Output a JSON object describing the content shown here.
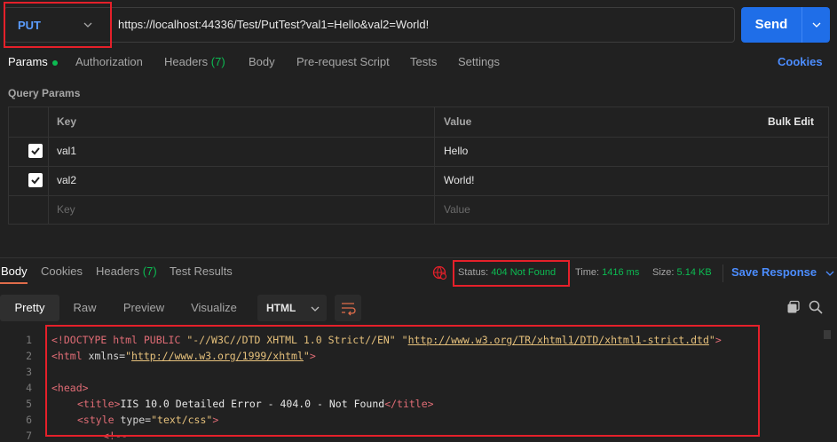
{
  "request": {
    "method": "PUT",
    "url": "https://localhost:44336/Test/PutTest?val1=Hello&val2=World!",
    "send_label": "Send"
  },
  "request_tabs": {
    "params": "Params",
    "authorization": "Authorization",
    "headers": "Headers",
    "headers_count": "(7)",
    "body": "Body",
    "prerequest": "Pre-request Script",
    "tests": "Tests",
    "settings": "Settings",
    "cookies": "Cookies"
  },
  "query_params": {
    "title": "Query Params",
    "col_key": "Key",
    "col_value": "Value",
    "bulk_edit": "Bulk Edit",
    "rows": [
      {
        "key": "val1",
        "value": "Hello",
        "checked": true
      },
      {
        "key": "val2",
        "value": "World!",
        "checked": true
      }
    ],
    "key_placeholder": "Key",
    "value_placeholder": "Value"
  },
  "response_tabs": {
    "body": "Body",
    "cookies": "Cookies",
    "headers": "Headers",
    "headers_count": "(7)",
    "test_results": "Test Results"
  },
  "response_meta": {
    "status_label": "Status:",
    "status_value": "404 Not Found",
    "time_label": "Time:",
    "time_value": "1416 ms",
    "size_label": "Size:",
    "size_value": "5.14 KB",
    "save_response": "Save Response"
  },
  "view_modes": {
    "pretty": "Pretty",
    "raw": "Raw",
    "preview": "Preview",
    "visualize": "Visualize",
    "format": "HTML"
  },
  "code_lines": {
    "l1_open": "<!DOCTYPE html PUBLIC ",
    "l1_s1": "\"-//W3C//DTD XHTML 1.0 Strict//EN\"",
    "l1_link": "http://www.w3.org/TR/xhtml1/DTD/xhtml1-strict.dtd",
    "l1_close": ">",
    "l2_tag": "<html",
    "l2_attr": " xmlns=",
    "l2_link": "http://www.w3.org/1999/xhtml",
    "l2_close": ">",
    "l4_tag": "<head>",
    "l5_open": "<title>",
    "l5_text": "IIS 10.0 Detailed Error - 404.0 - Not Found",
    "l5_close": "</title>",
    "l6_tag": "<style",
    "l6_attr": " type=",
    "l6_val": "\"text/css\"",
    "l6_close": ">",
    "l7_text": "<!--"
  },
  "line_numbers": [
    "1",
    "2",
    "3",
    "4",
    "5",
    "6",
    "7"
  ],
  "colors": {
    "accent": "#1f6ee8",
    "status_ok": "#0cbb52",
    "method": "#5b9dff",
    "highlight": "#e5202a"
  }
}
